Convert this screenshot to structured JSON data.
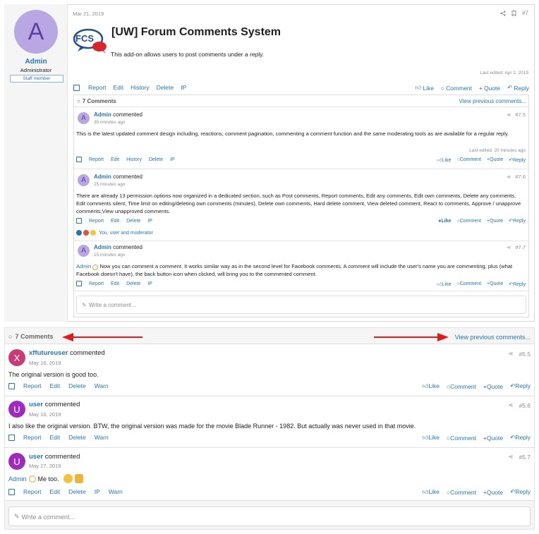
{
  "post": {
    "date": "Mar 21, 2019",
    "number": "#7",
    "title": "[UW] Forum Comments System",
    "description": "This add-on allows users to post comments under a reply.",
    "last_edited": "Last edited: Apr 2, 2019",
    "logo_text": "FCS",
    "author": {
      "initial": "A",
      "name": "Admin",
      "role": "Administrator",
      "badge": "Staff member"
    },
    "actions": {
      "report": "Report",
      "edit": "Edit",
      "history": "History",
      "delete": "Delete",
      "ip": "IP",
      "like": "Like",
      "comment": "Comment",
      "quote": "Quote",
      "reply": "Reply"
    }
  },
  "inner": {
    "header": "7 Comments",
    "view_previous": "View previous comments...",
    "write_placeholder": "Write a comment...",
    "comments": [
      {
        "initial": "A",
        "name": "Admin",
        "verb": "commented",
        "time": "35 minutes ago",
        "number": "#7.5",
        "text": "This is the latest updated comment design including, reactions, comment pagination, commenting a comment function and the same moderating tools as are available for a regular reply.",
        "edited": "Last edited: 20 minutes ago",
        "actions": [
          "Report",
          "Edit",
          "History",
          "Delete",
          "IP"
        ]
      },
      {
        "initial": "A",
        "name": "Admin",
        "verb": "commented",
        "time": "25 minutes ago",
        "number": "#7.6",
        "text": "There are already 13 permission options now organized in a dedicated section, such as Post comments, Report comments, Edit any comments, Edit own comments, Delete any comments, Edit comments silent, Time limit on editing/deleting own comments (minutes), Delete own comments, Hard delete comment, View deleted comment, React to comments, Approve / unapprove comments,View unapproved comments.",
        "actions": [
          "Report",
          "Edit",
          "Delete",
          "IP"
        ],
        "reactions": "You, user and moderator"
      },
      {
        "initial": "A",
        "name": "Admin",
        "verb": "commented",
        "time": "15 minutes ago",
        "number": "#7.7",
        "mention": "Admin",
        "text": "Now you can comment a comment. It works similar way as in the second level for Facebook comments. A comment will include the user's name you are commenting, plus (what Facebook doesn't have), the back button icon when clicked, will bring you to the commented comment.",
        "actions": [
          "Report",
          "Edit",
          "Delete",
          "IP"
        ]
      }
    ],
    "labels": {
      "like": "Like",
      "comment": "Comment",
      "quote": "Quote",
      "reply": "Reply"
    }
  },
  "outer": {
    "header": "7 Comments",
    "view_previous": "View previous comments...",
    "write_placeholder": "Write a comment...",
    "comments": [
      {
        "initial": "X",
        "name": "xffutureuser",
        "verb": "commented",
        "date": "May 16, 2019",
        "number": "#5.5",
        "text": "The original version is good too.",
        "actions": [
          "Report",
          "Edit",
          "Delete",
          "Warn"
        ]
      },
      {
        "initial": "U",
        "name": "user",
        "verb": "commented",
        "date": "May 16, 2019",
        "number": "#5.6",
        "text": "I also like the original version. BTW, the original version was made for the movie Blade Runner - 1982. But actually was never used in that movie.",
        "actions": [
          "Report",
          "Edit",
          "Delete",
          "Warn"
        ]
      },
      {
        "initial": "U",
        "name": "user",
        "verb": "commented",
        "date": "May 27, 2019",
        "number": "#5.7",
        "mention": "Admin",
        "text": "Me too.",
        "actions": [
          "Report",
          "Edit",
          "Delete",
          "IP",
          "Warn"
        ]
      }
    ],
    "labels": {
      "like": "Like",
      "comment": "Comment",
      "quote": "Quote",
      "reply": "Reply"
    }
  },
  "colors": {
    "link": "#2577b1",
    "arrow": "#e01b1b",
    "like_active": "#2577b1"
  }
}
